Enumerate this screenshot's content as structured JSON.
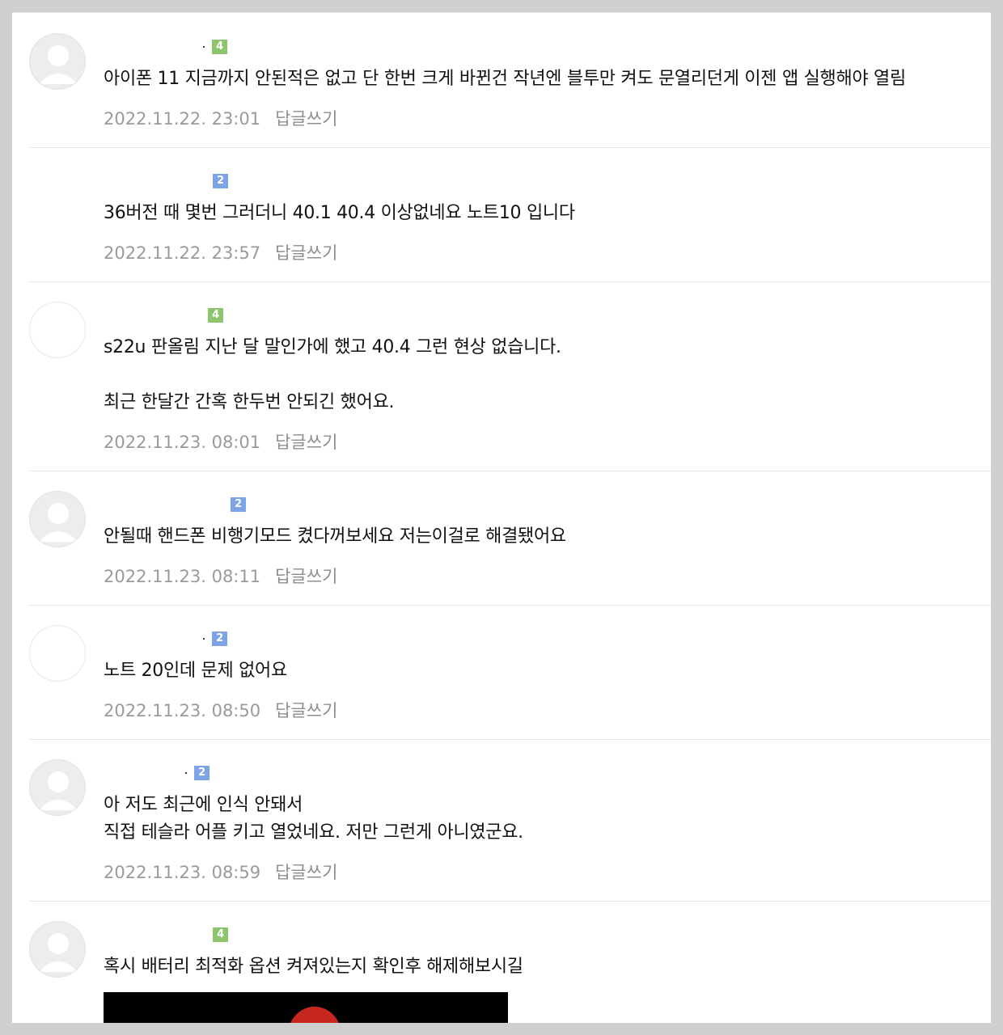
{
  "comments": [
    {
      "level": "4",
      "levelColor": "#8dc46e",
      "text": "아이폰 11 지금까지 안된적은 없고 단 한번 크게 바뀐건 작년엔 블투만 켜도 문열리던게 이젠 앱 실행해야 열림",
      "date": "2022.11.22. 23:01",
      "reply": "답글쓰기"
    },
    {
      "level": "2",
      "levelColor": "#7ea4e8",
      "text": "36버전 때 몇번 그러더니 40.1 40.4 이상없네요 노트10 입니다",
      "date": "2022.11.22. 23:57",
      "reply": "답글쓰기"
    },
    {
      "level": "4",
      "levelColor": "#8dc46e",
      "text": "s22u 판올림 지난 달 말인가에 했고 40.4 그런 현상 없습니다.\n\n최근 한달간 간혹 한두번 안되긴 했어요.",
      "date": "2022.11.23. 08:01",
      "reply": "답글쓰기"
    },
    {
      "level": "2",
      "levelColor": "#7ea4e8",
      "text": "안될때 핸드폰 비행기모드 켰다꺼보세요 저는이걸로 해결됐어요",
      "date": "2022.11.23. 08:11",
      "reply": "답글쓰기"
    },
    {
      "level": "2",
      "levelColor": "#7ea4e8",
      "text": "노트 20인데 문제 없어요",
      "date": "2022.11.23. 08:50",
      "reply": "답글쓰기"
    },
    {
      "level": "2",
      "levelColor": "#7ea4e8",
      "text": "아 저도 최근에 인식 안돼서\n직접 테슬라 어플 키고 열었네요. 저만 그런게 아니였군요.",
      "date": "2022.11.23. 08:59",
      "reply": "답글쓰기"
    },
    {
      "level": "4",
      "levelColor": "#8dc46e",
      "text": "혹시 배터리 최적화 옵션 켜져있는지 확인후 해제해보시길",
      "date": "",
      "reply": ""
    }
  ]
}
